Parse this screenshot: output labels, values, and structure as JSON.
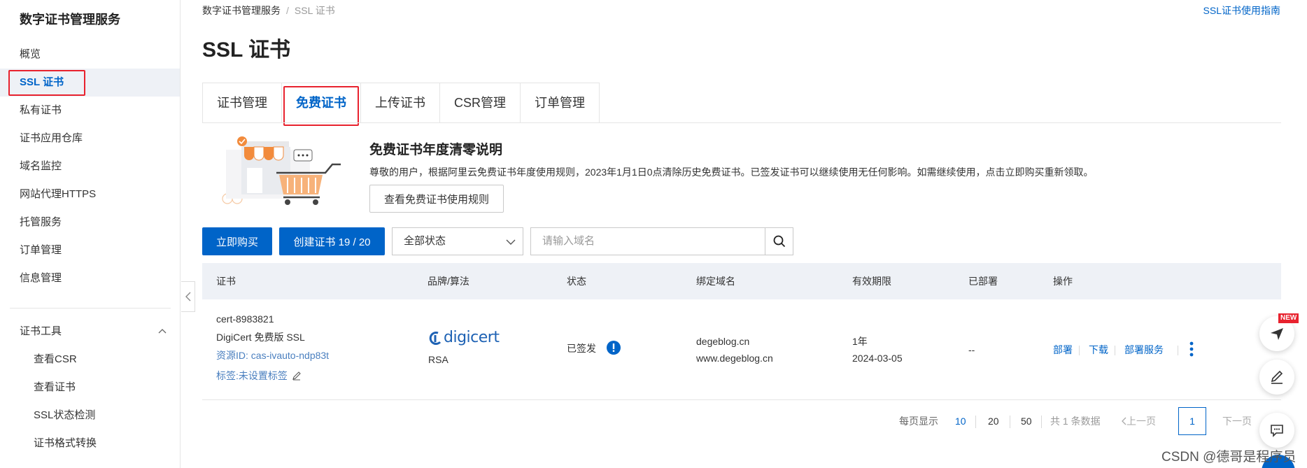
{
  "sidebar": {
    "title": "数字证书管理服务",
    "items": [
      {
        "label": "概览"
      },
      {
        "label": "SSL 证书"
      },
      {
        "label": "私有证书"
      },
      {
        "label": "证书应用仓库"
      },
      {
        "label": "域名监控"
      },
      {
        "label": "网站代理HTTPS"
      },
      {
        "label": "托管服务"
      },
      {
        "label": "订单管理"
      },
      {
        "label": "信息管理"
      }
    ],
    "tools_group": {
      "title": "证书工具",
      "items": [
        {
          "label": "查看CSR"
        },
        {
          "label": "查看证书"
        },
        {
          "label": "SSL状态检测"
        },
        {
          "label": "证书格式转换"
        }
      ]
    }
  },
  "breadcrumb": {
    "root": "数字证书管理服务",
    "separator": "/",
    "current": "SSL 证书"
  },
  "guide_link": "SSL证书使用指南",
  "page_title": "SSL 证书",
  "tabs": [
    {
      "label": "证书管理"
    },
    {
      "label": "免费证书"
    },
    {
      "label": "上传证书"
    },
    {
      "label": "CSR管理"
    },
    {
      "label": "订单管理"
    }
  ],
  "notice": {
    "title": "免费证书年度清零说明",
    "text": "尊敬的用户，根据阿里云免费证书年度使用规则，2023年1月1日0点清除历史免费证书。已签发证书可以继续使用无任何影响。如需继续使用，点击立即购买重新领取。",
    "button": "查看免费证书使用规则"
  },
  "toolbar": {
    "buy_label": "立即购买",
    "create_label": "创建证书 19 / 20",
    "status_select": "全部状态",
    "search_placeholder": "请输入域名"
  },
  "table": {
    "headers": [
      "证书",
      "品牌/算法",
      "状态",
      "绑定域名",
      "有效期限",
      "已部署",
      "操作"
    ],
    "rows": [
      {
        "cert_name": "cert-8983821",
        "cert_type": "DigiCert 免费版 SSL",
        "resource_id": "资源ID: cas-ivauto-ndp83t",
        "tag": "标签:未设置标签",
        "brand": "digicert",
        "algorithm": "RSA",
        "status": "已签发",
        "domain1": "degeblog.cn",
        "domain2": "www.degeblog.cn",
        "validity": "1年",
        "expiry": "2024-03-05",
        "deployed": "--",
        "actions": [
          "部署",
          "下载",
          "部署服务"
        ]
      }
    ]
  },
  "pagination": {
    "per_page_label": "每页显示",
    "sizes": [
      "10",
      "20",
      "50"
    ],
    "total": "共 1 条数据",
    "prev": "上一页",
    "current": "1",
    "next": "下一页"
  },
  "float": {
    "new_badge": "NEW"
  },
  "watermark": "CSDN @德哥是程序员",
  "colors": {
    "accent": "#0064c8",
    "highlight_box": "#e8222e",
    "table_head_bg": "#eef1f6"
  }
}
